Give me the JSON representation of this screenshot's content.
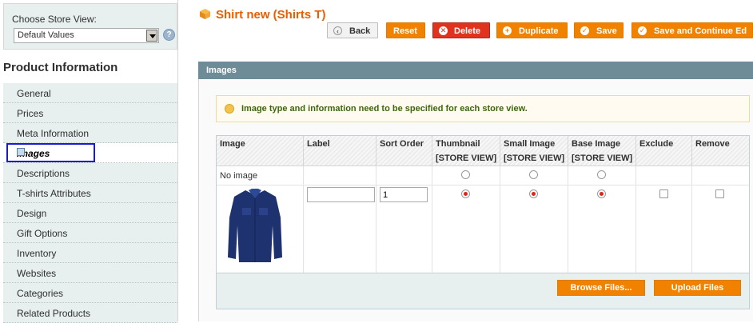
{
  "store_switcher": {
    "label": "Choose Store View:",
    "selected": "Default Values",
    "help_icon": "help-icon"
  },
  "sidebar": {
    "title": "Product Information",
    "items": [
      {
        "label": "General"
      },
      {
        "label": "Prices"
      },
      {
        "label": "Meta Information"
      },
      {
        "label": "Images",
        "active": true
      },
      {
        "label": "Descriptions"
      },
      {
        "label": "T-shirts Attributes"
      },
      {
        "label": "Design"
      },
      {
        "label": "Gift Options"
      },
      {
        "label": "Inventory"
      },
      {
        "label": "Websites"
      },
      {
        "label": "Categories"
      },
      {
        "label": "Related Products"
      }
    ]
  },
  "header": {
    "title": "Shirt new (Shirts T)",
    "buttons": {
      "back": "Back",
      "reset": "Reset",
      "delete": "Delete",
      "duplicate": "Duplicate",
      "save": "Save",
      "save_continue": "Save and Continue Ed"
    }
  },
  "panel": {
    "title": "Images",
    "notice": "Image type and information need to be specified for each store view.",
    "columns": [
      {
        "line1": "Image",
        "line2": ""
      },
      {
        "line1": "Label",
        "line2": ""
      },
      {
        "line1": "Sort Order",
        "line2": ""
      },
      {
        "line1": "Thumbnail",
        "line2": "[STORE VIEW]"
      },
      {
        "line1": "Small Image",
        "line2": "[STORE VIEW]"
      },
      {
        "line1": "Base Image",
        "line2": "[STORE VIEW]"
      },
      {
        "line1": "Exclude",
        "line2": ""
      },
      {
        "line1": "Remove",
        "line2": ""
      }
    ],
    "rows": {
      "no_image": {
        "label": "No image",
        "thumbnail": false,
        "small": false,
        "base": false
      },
      "image": {
        "label_value": "",
        "sort_order": "1",
        "thumbnail": true,
        "small": true,
        "base": true,
        "exclude": false,
        "remove": false
      }
    },
    "browse_button": "Browse Files...",
    "upload_button": "Upload Files"
  },
  "colors": {
    "accent": "#eb5e00",
    "button": "#f18200",
    "panel_header": "#6e8c97",
    "delete": "#e0321c"
  }
}
